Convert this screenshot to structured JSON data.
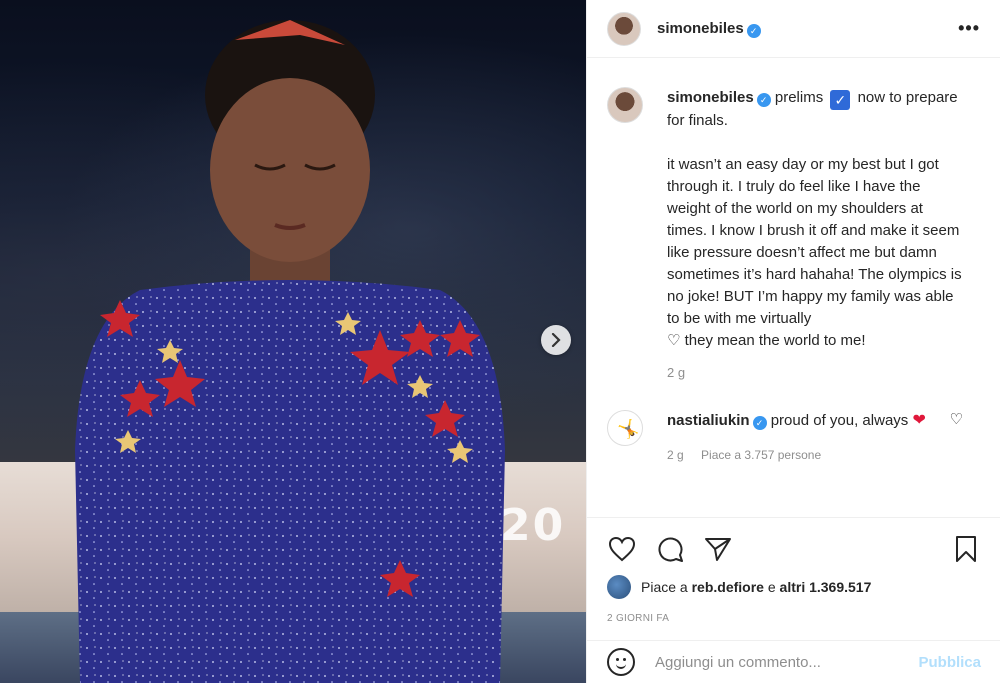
{
  "post": {
    "username": "simonebiles",
    "verified_icon": "verified-badge-icon",
    "more_label": "•••"
  },
  "photo": {
    "beam_number": "20",
    "next_icon": "chevron-right-icon"
  },
  "caption": {
    "username": "simonebiles",
    "line1_a": "prelims",
    "line1_b": "now to prepare for finals.",
    "body": "it wasn’t an easy day or my best but I got through it. I truly do feel like I have the weight of the world on my shoulders at times. I know I brush it off and make it seem like pressure doesn’t affect me but damn sometimes it’s hard hahaha! The olympics is no joke! BUT I’m happy my family was able to be with me virtually",
    "body_end": "they mean the world to me!",
    "time": "2 g"
  },
  "comment": {
    "username": "nastialiukin",
    "text": "proud of you, always",
    "time": "2 g",
    "likes": "Piace a 3.757 persone"
  },
  "likes": {
    "prefix": "Piace a",
    "user": "reb.defiore",
    "middle": "e",
    "others": "altri 1.369.517"
  },
  "posted_ago": "2 GIORNI FA",
  "add_comment": {
    "placeholder": "Aggiungi un commento...",
    "publish_label": "Pubblica"
  },
  "colors": {
    "accent": "#3897f0",
    "publish_disabled": "#b2dffc",
    "heart": "#e0183b"
  }
}
